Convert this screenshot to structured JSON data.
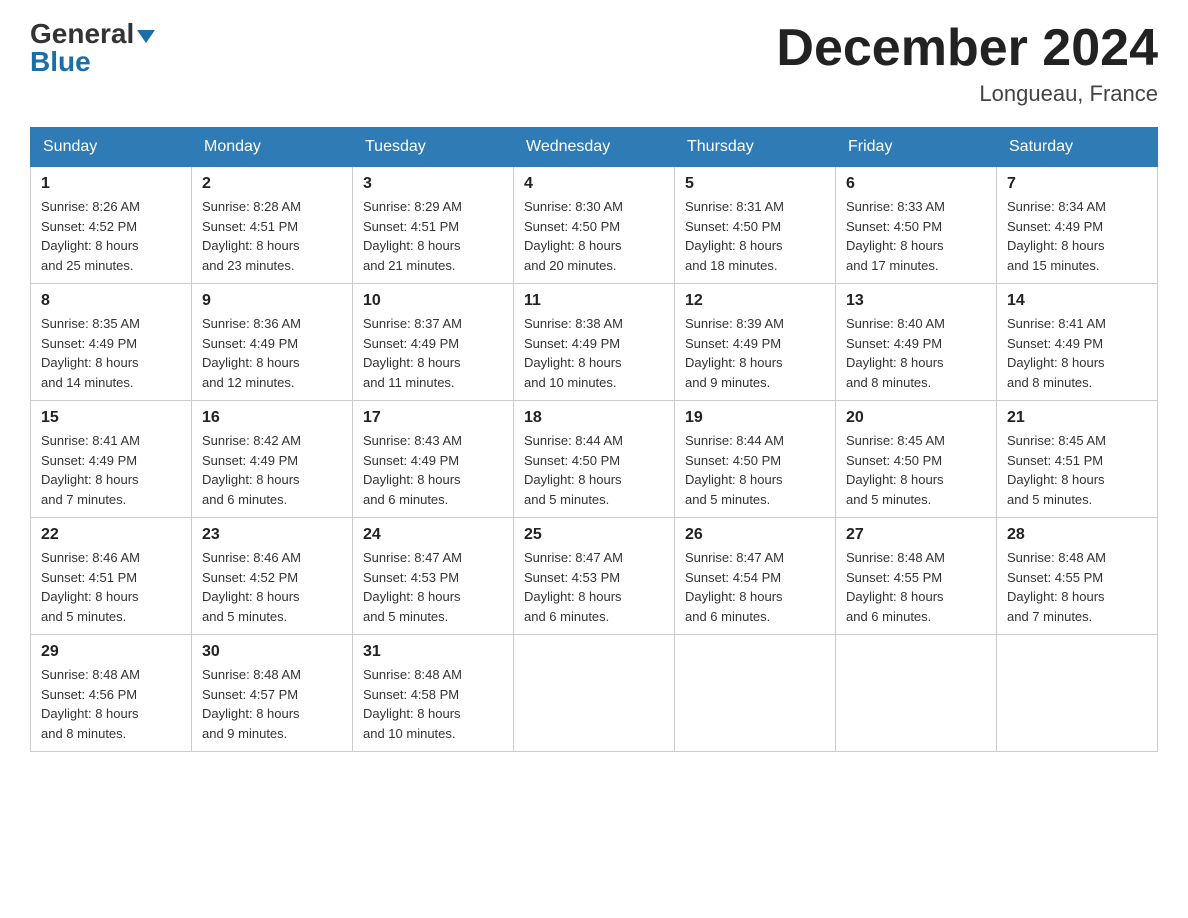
{
  "header": {
    "logo_general": "General",
    "logo_blue": "Blue",
    "month_title": "December 2024",
    "location": "Longueau, France"
  },
  "weekdays": [
    "Sunday",
    "Monday",
    "Tuesday",
    "Wednesday",
    "Thursday",
    "Friday",
    "Saturday"
  ],
  "weeks": [
    [
      {
        "day": "1",
        "sunrise": "8:26 AM",
        "sunset": "4:52 PM",
        "daylight": "8 hours and 25 minutes."
      },
      {
        "day": "2",
        "sunrise": "8:28 AM",
        "sunset": "4:51 PM",
        "daylight": "8 hours and 23 minutes."
      },
      {
        "day": "3",
        "sunrise": "8:29 AM",
        "sunset": "4:51 PM",
        "daylight": "8 hours and 21 minutes."
      },
      {
        "day": "4",
        "sunrise": "8:30 AM",
        "sunset": "4:50 PM",
        "daylight": "8 hours and 20 minutes."
      },
      {
        "day": "5",
        "sunrise": "8:31 AM",
        "sunset": "4:50 PM",
        "daylight": "8 hours and 18 minutes."
      },
      {
        "day": "6",
        "sunrise": "8:33 AM",
        "sunset": "4:50 PM",
        "daylight": "8 hours and 17 minutes."
      },
      {
        "day": "7",
        "sunrise": "8:34 AM",
        "sunset": "4:49 PM",
        "daylight": "8 hours and 15 minutes."
      }
    ],
    [
      {
        "day": "8",
        "sunrise": "8:35 AM",
        "sunset": "4:49 PM",
        "daylight": "8 hours and 14 minutes."
      },
      {
        "day": "9",
        "sunrise": "8:36 AM",
        "sunset": "4:49 PM",
        "daylight": "8 hours and 12 minutes."
      },
      {
        "day": "10",
        "sunrise": "8:37 AM",
        "sunset": "4:49 PM",
        "daylight": "8 hours and 11 minutes."
      },
      {
        "day": "11",
        "sunrise": "8:38 AM",
        "sunset": "4:49 PM",
        "daylight": "8 hours and 10 minutes."
      },
      {
        "day": "12",
        "sunrise": "8:39 AM",
        "sunset": "4:49 PM",
        "daylight": "8 hours and 9 minutes."
      },
      {
        "day": "13",
        "sunrise": "8:40 AM",
        "sunset": "4:49 PM",
        "daylight": "8 hours and 8 minutes."
      },
      {
        "day": "14",
        "sunrise": "8:41 AM",
        "sunset": "4:49 PM",
        "daylight": "8 hours and 8 minutes."
      }
    ],
    [
      {
        "day": "15",
        "sunrise": "8:41 AM",
        "sunset": "4:49 PM",
        "daylight": "8 hours and 7 minutes."
      },
      {
        "day": "16",
        "sunrise": "8:42 AM",
        "sunset": "4:49 PM",
        "daylight": "8 hours and 6 minutes."
      },
      {
        "day": "17",
        "sunrise": "8:43 AM",
        "sunset": "4:49 PM",
        "daylight": "8 hours and 6 minutes."
      },
      {
        "day": "18",
        "sunrise": "8:44 AM",
        "sunset": "4:50 PM",
        "daylight": "8 hours and 5 minutes."
      },
      {
        "day": "19",
        "sunrise": "8:44 AM",
        "sunset": "4:50 PM",
        "daylight": "8 hours and 5 minutes."
      },
      {
        "day": "20",
        "sunrise": "8:45 AM",
        "sunset": "4:50 PM",
        "daylight": "8 hours and 5 minutes."
      },
      {
        "day": "21",
        "sunrise": "8:45 AM",
        "sunset": "4:51 PM",
        "daylight": "8 hours and 5 minutes."
      }
    ],
    [
      {
        "day": "22",
        "sunrise": "8:46 AM",
        "sunset": "4:51 PM",
        "daylight": "8 hours and 5 minutes."
      },
      {
        "day": "23",
        "sunrise": "8:46 AM",
        "sunset": "4:52 PM",
        "daylight": "8 hours and 5 minutes."
      },
      {
        "day": "24",
        "sunrise": "8:47 AM",
        "sunset": "4:53 PM",
        "daylight": "8 hours and 5 minutes."
      },
      {
        "day": "25",
        "sunrise": "8:47 AM",
        "sunset": "4:53 PM",
        "daylight": "8 hours and 6 minutes."
      },
      {
        "day": "26",
        "sunrise": "8:47 AM",
        "sunset": "4:54 PM",
        "daylight": "8 hours and 6 minutes."
      },
      {
        "day": "27",
        "sunrise": "8:48 AM",
        "sunset": "4:55 PM",
        "daylight": "8 hours and 6 minutes."
      },
      {
        "day": "28",
        "sunrise": "8:48 AM",
        "sunset": "4:55 PM",
        "daylight": "8 hours and 7 minutes."
      }
    ],
    [
      {
        "day": "29",
        "sunrise": "8:48 AM",
        "sunset": "4:56 PM",
        "daylight": "8 hours and 8 minutes."
      },
      {
        "day": "30",
        "sunrise": "8:48 AM",
        "sunset": "4:57 PM",
        "daylight": "8 hours and 9 minutes."
      },
      {
        "day": "31",
        "sunrise": "8:48 AM",
        "sunset": "4:58 PM",
        "daylight": "8 hours and 10 minutes."
      },
      null,
      null,
      null,
      null
    ]
  ],
  "labels": {
    "sunrise": "Sunrise:",
    "sunset": "Sunset:",
    "daylight": "Daylight:"
  }
}
